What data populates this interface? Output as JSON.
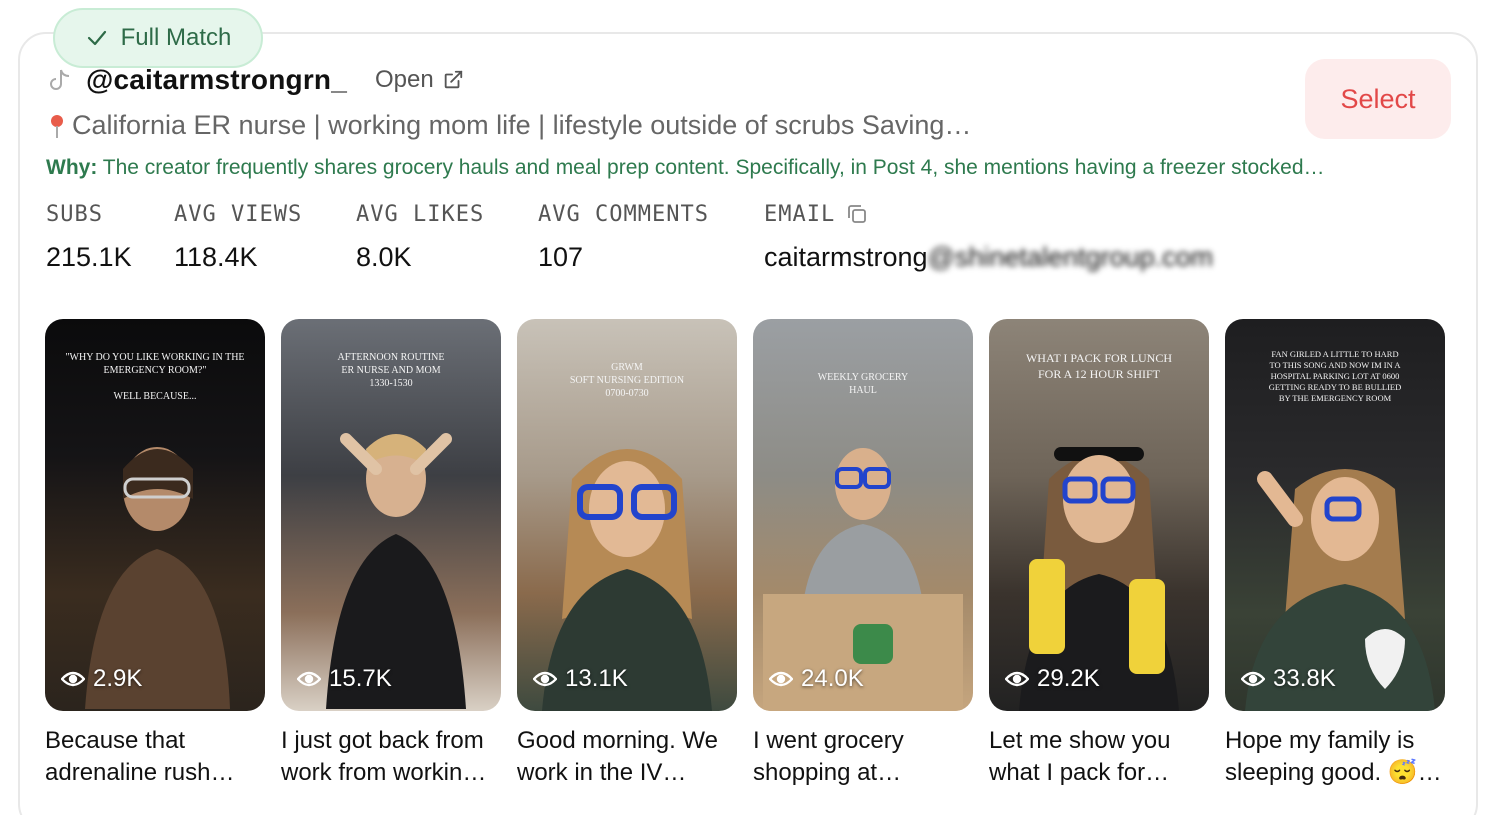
{
  "match_badge": {
    "label": "Full Match",
    "icon": "check-icon",
    "color": "#2e6b48"
  },
  "creator": {
    "platform_icon": "tiktok-icon",
    "handle": "@caitarmstrongrn_",
    "open_label": "Open",
    "bio": "California ER nurse | working mom life | lifestyle outside of scrubs Saving…",
    "why_label": "Why:",
    "why_text": " The creator frequently shares grocery hauls and meal prep content. Specifically, in Post 4, she mentions having a freezer stocked…"
  },
  "select_button": {
    "label": "Select",
    "color": "#e24848"
  },
  "stats": {
    "subs": {
      "label": "SUBS",
      "value": "215.1K"
    },
    "avg_views": {
      "label": "AVG VIEWS",
      "value": "118.4K"
    },
    "avg_likes": {
      "label": "AVG LIKES",
      "value": "8.0K"
    },
    "avg_comments": {
      "label": "AVG COMMENTS",
      "value": "107"
    },
    "email": {
      "label": "EMAIL",
      "value_clear": "caitarmstrong",
      "value_blurred": "@shinetalentgroup.com"
    }
  },
  "videos": [
    {
      "overlay": "\"Why do you like working in the emergency room?\"\n\nWell because...",
      "views": "2.9K",
      "caption": "Because that adrenaline rush…"
    },
    {
      "overlay": "Afternoon routine\nER nurse and mom\n1330-1530",
      "views": "15.7K",
      "caption": "I just got back from work from workin…"
    },
    {
      "overlay": "GRWM\nsoft nursing edition\n0700-0730",
      "views": "13.1K",
      "caption": "Good morning. We work in the IV…"
    },
    {
      "overlay": "Weekly grocery haul",
      "views": "24.0K",
      "caption": "I went grocery shopping at…"
    },
    {
      "overlay": "What I pack for lunch for a 12 hour shift",
      "views": "29.2K",
      "caption": "Let me show you what I pack for…"
    },
    {
      "overlay": "Fan girled a little to hard to this song and now im in a hospital parking lot at 0600 getting ready to be bullied by the emergency room",
      "views": "33.8K",
      "caption": "Hope my family is sleeping good. 😴…"
    }
  ]
}
